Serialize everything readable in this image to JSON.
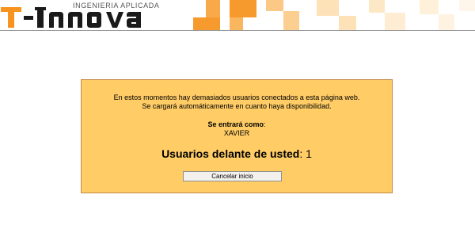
{
  "header": {
    "logo_text": "T-Innova",
    "logo_tagline": "INGENIERIA APLICADA",
    "colors": {
      "brand_orange": "#f7931e",
      "tile_orange": "#f79a2e",
      "tile_light": "#fde2b8",
      "tile_pale": "#fef0d9"
    }
  },
  "notice": {
    "background": "#ffcc66",
    "message_line1": "En estos momentos hay demasiados usuarios conectados a esta página web.",
    "message_line2": "Se cargará automáticamente en cuanto haya disponibilidad.",
    "enter_as_label": "Se entrará como",
    "enter_as_colon": ":",
    "username": "XAVIER",
    "queue_label": "Usuarios delante de usted",
    "queue_colon": ":",
    "queue_count": "1",
    "cancel_button_label": "Cancelar inicio"
  }
}
